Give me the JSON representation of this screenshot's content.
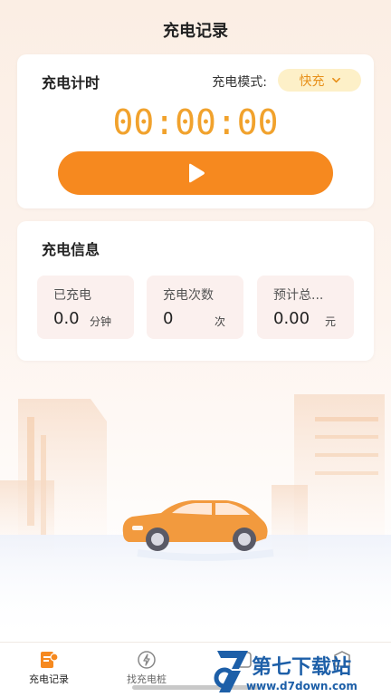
{
  "header": {
    "title": "充电记录"
  },
  "timer_card": {
    "title": "充电计时",
    "mode_label": "充电模式:",
    "mode_value": "快充",
    "time": "00:00:00",
    "play_icon": "play-icon"
  },
  "info_card": {
    "title": "充电信息",
    "stats": [
      {
        "label": "已充电",
        "value": "0.0",
        "unit": "分钟"
      },
      {
        "label": "充电次数",
        "value": "0",
        "unit": "次"
      },
      {
        "label": "预计总...",
        "value": "0.00",
        "unit": "元"
      }
    ]
  },
  "tabbar": {
    "items": [
      {
        "label": "充电记录",
        "icon": "record-icon",
        "active": true
      },
      {
        "label": "找充电桩",
        "icon": "charger-icon",
        "active": false
      },
      {
        "label": "",
        "icon": "tab3-icon",
        "active": false
      },
      {
        "label": "",
        "icon": "tab4-icon",
        "active": false
      }
    ]
  },
  "watermark": {
    "brand": "第七下载站",
    "url": "www.d7down.com"
  },
  "colors": {
    "accent": "#f6891f",
    "timer": "#f1a22d",
    "mode_bg": "#fdf0c8",
    "mode_text": "#e7901a"
  }
}
